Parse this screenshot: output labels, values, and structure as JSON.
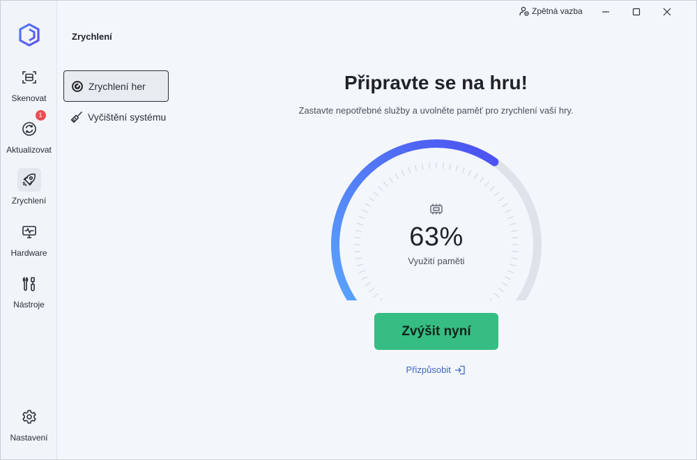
{
  "rail": {
    "items": [
      {
        "label": "Skenovat",
        "icon": "scan-icon"
      },
      {
        "label": "Aktualizovat",
        "icon": "refresh-icon",
        "badge": "1"
      },
      {
        "label": "Zrychlení",
        "icon": "rocket-icon",
        "active": true
      },
      {
        "label": "Hardware",
        "icon": "monitor-pulse-icon"
      },
      {
        "label": "Nástroje",
        "icon": "tools-icon"
      }
    ],
    "settings_label": "Nastavení"
  },
  "subnav": {
    "title": "Zrychlení",
    "items": [
      {
        "label": "Zrychlení her",
        "icon": "gauge-icon",
        "active": true
      },
      {
        "label": "Vyčištění systému",
        "icon": "broom-icon"
      }
    ]
  },
  "titlebar": {
    "feedback_label": "Zpětná vazba"
  },
  "main": {
    "headline": "Připravte se na hru!",
    "subline": "Zastavte nepotřebné služby a uvolněte paměť pro zrychlení vaší hry.",
    "memory_percent_text": "63%",
    "memory_usage_fraction": 0.63,
    "memory_label": "Využití paměti",
    "boost_button": "Zvýšit nyní",
    "customize_link": "Přizpůsobit"
  },
  "colors": {
    "accent_green": "#36bd83",
    "gauge_start": "#5aa8ff",
    "gauge_end": "#4b4ff0",
    "gauge_track": "#dfe2e8",
    "link": "#3f66c4",
    "badge": "#ee4c54"
  }
}
